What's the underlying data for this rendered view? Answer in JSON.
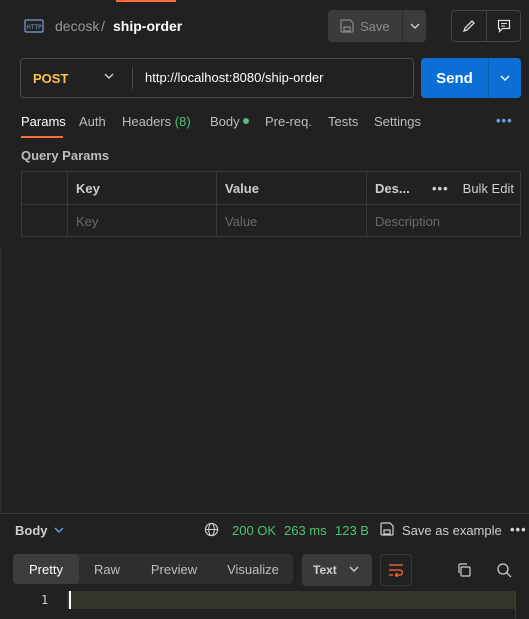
{
  "header": {
    "workspace": "decosk",
    "separator": "/",
    "request_name": "ship-order",
    "save_label": "Save"
  },
  "request": {
    "method": "POST",
    "url": "http://localhost:8080/ship-order",
    "send_label": "Send"
  },
  "tabs": {
    "params": "Params",
    "auth": "Auth",
    "headers": "Headers",
    "headers_count": "(8)",
    "body": "Body",
    "prereq": "Pre-req.",
    "tests": "Tests",
    "settings": "Settings",
    "more": "•••"
  },
  "query_params": {
    "title": "Query Params",
    "columns": {
      "key": "Key",
      "value": "Value",
      "description": "Des..."
    },
    "bulk_edit": "Bulk Edit",
    "bulk_dots": "•••",
    "placeholders": {
      "key": "Key",
      "value": "Value",
      "description": "Description"
    }
  },
  "response": {
    "body_label": "Body",
    "status": "200 OK",
    "time": "263 ms",
    "size": "123 B",
    "save_example": "Save as example",
    "more": "•••",
    "views": [
      "Pretty",
      "Raw",
      "Preview",
      "Visualize"
    ],
    "format": "Text",
    "line_number": "1"
  },
  "colors": {
    "accent": "#ff6c37",
    "method": "#ffc24b",
    "send": "#0b6fd6",
    "success": "#4ec27a"
  }
}
